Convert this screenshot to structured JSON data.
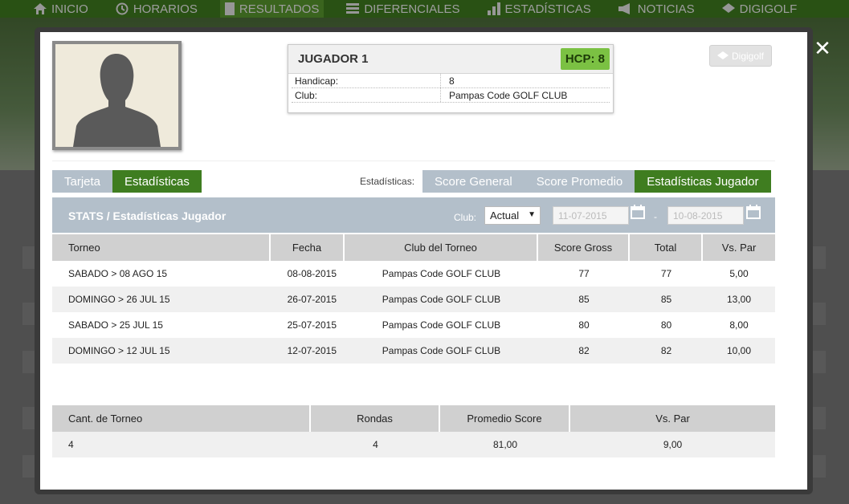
{
  "nav": {
    "items": [
      {
        "label": "INICIO",
        "icon": "home-icon"
      },
      {
        "label": "HORARIOS",
        "icon": "clock-icon"
      },
      {
        "label": "RESULTADOS",
        "icon": "document-icon"
      },
      {
        "label": "DIFERENCIALES",
        "icon": "list-icon"
      },
      {
        "label": "ESTADÍSTICAS",
        "icon": "bar-chart-icon"
      },
      {
        "label": "NOTICIAS",
        "icon": "megaphone-icon"
      },
      {
        "label": "DIGIGOLF",
        "icon": "digigolf-icon"
      }
    ]
  },
  "player": {
    "name": "JUGADOR 1",
    "hcp_badge": "HCP: 8",
    "handicap_label": "Handicap:",
    "handicap_value": "8",
    "club_label": "Club:",
    "club_value": "Pampas Code GOLF CLUB"
  },
  "digigolf_button": "Digigolf",
  "tabs_left": [
    "Tarjeta",
    "Estadísticas"
  ],
  "stats_label": "Estadísticas:",
  "tabs_right": [
    "Score General",
    "Score Promedio",
    "Estadísticas Jugador"
  ],
  "filter": {
    "title": "STATS / Estadísticas Jugador",
    "club_label": "Club:",
    "club_selected": "Actual",
    "date_from": "11-07-2015",
    "date_to": "10-08-2015",
    "dash": "-"
  },
  "results_table": {
    "headers": [
      "Torneo",
      "Fecha",
      "Club del Torneo",
      "Score Gross",
      "Total",
      "Vs. Par"
    ],
    "rows": [
      [
        "SABADO > 08 AGO 15",
        "08-08-2015",
        "Pampas Code GOLF CLUB",
        "77",
        "77",
        "5,00"
      ],
      [
        "DOMINGO > 26 JUL 15",
        "26-07-2015",
        "Pampas Code GOLF CLUB",
        "85",
        "85",
        "13,00"
      ],
      [
        "SABADO > 25 JUL 15",
        "25-07-2015",
        "Pampas Code GOLF CLUB",
        "80",
        "80",
        "8,00"
      ],
      [
        "DOMINGO > 12 JUL 15",
        "12-07-2015",
        "Pampas Code GOLF CLUB",
        "82",
        "82",
        "10,00"
      ]
    ]
  },
  "summary_table": {
    "headers": [
      "Cant. de Torneo",
      "Rondas",
      "Promedio Score",
      "Vs. Par"
    ],
    "row": [
      "4",
      "4",
      "81,00",
      "9,00"
    ]
  },
  "colors": {
    "accent_green": "#3f7d20",
    "hcp_green": "#7bc143",
    "tab_inactive": "#b3bfca"
  }
}
